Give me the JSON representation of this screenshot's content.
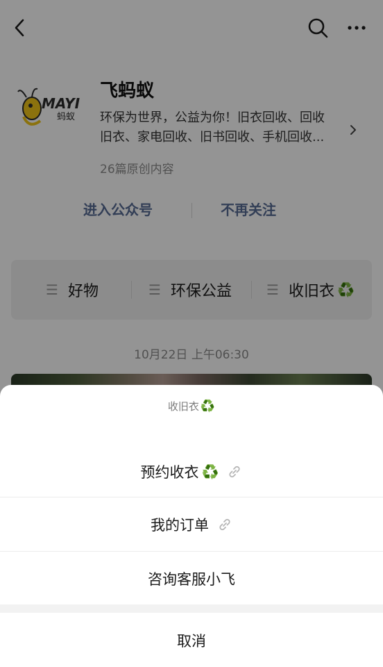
{
  "account": {
    "name": "飞蚂蚁",
    "logo_text": "MAYI",
    "logo_sub": "蚂蚁",
    "description_line1": "环保为世界，公益为你！旧衣回收、回收",
    "description_line2": "旧衣、家电回收、旧书回收、手机回收...",
    "article_count": "26篇原创内容",
    "enter_label": "进入公众号",
    "unfollow_label": "不再关注"
  },
  "menu": [
    {
      "label": "好物",
      "icon": "menu-lines-icon"
    },
    {
      "label": "环保公益",
      "icon": "menu-lines-icon"
    },
    {
      "label": "收旧衣",
      "icon": "menu-lines-icon",
      "badge": "♻️"
    }
  ],
  "post": {
    "time": "10月22日 上午06:30"
  },
  "sheet": {
    "title": "收旧衣",
    "title_badge": "♻️",
    "items": [
      {
        "label": "预约收衣",
        "badge": "♻️",
        "has_link_icon": true
      },
      {
        "label": "我的订单",
        "has_link_icon": true
      },
      {
        "label": "咨询客服小飞",
        "has_link_icon": false
      }
    ],
    "cancel_label": "取消"
  },
  "colors": {
    "accent": "#576b95",
    "recycle": "#2e9e3a",
    "overlay": "rgba(0,0,0,0.42)"
  }
}
